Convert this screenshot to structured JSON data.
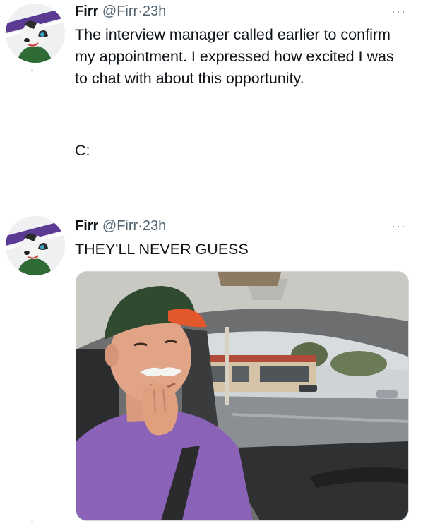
{
  "tweets": [
    {
      "author_name": "Firr",
      "handle": "@Firr",
      "separator": "·",
      "time": "23h",
      "more_label": "···",
      "text": "The interview manager called earlier to confirm my appointment. I expressed how excited I was to chat with about this opportunity.",
      "text2": "C:"
    },
    {
      "author_name": "Firr",
      "handle": "@Firr",
      "separator": "·",
      "time": "23h",
      "more_label": "···",
      "text": "THEY'LL NEVER GUESS"
    }
  ],
  "colors": {
    "text": "#0f1419",
    "secondary": "#536471",
    "avatar_stripe": "#5b3a93",
    "shirt": "#8a63b8",
    "cap": "#2f4a2e",
    "cap_brim": "#e2572b"
  }
}
